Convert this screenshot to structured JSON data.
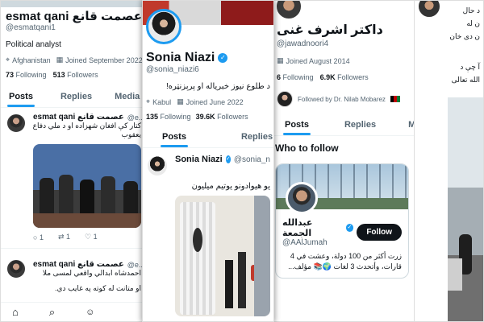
{
  "p1": {
    "name": "esmat qani عصمت قانع",
    "handle": "@esmatqani1",
    "bio": "Political analyst",
    "location": "Afghanistan",
    "joined": "Joined September 2022",
    "following_count": "73",
    "following_label": "Following",
    "followers_count": "513",
    "followers_label": "Followers",
    "tabs": [
      "Posts",
      "Replies",
      "Media"
    ],
    "tweet1": {
      "name": "esmat qani عصمت قانع",
      "handle": "@e...",
      "time": "04",
      "line1": "کتار کې افغان شهزاده او د ملي دفاع",
      "line2": "یعقوب",
      "reply": "1",
      "retweet": "1",
      "like": "1"
    },
    "tweet2": {
      "name": "esmat qani عصمت قانع",
      "handle": "@e...",
      "time": "04",
      "line1": "احمدشاه ابدالي واقعي لمسی ملا",
      "line2": "او متانت له کوته په غایب دي."
    }
  },
  "p2": {
    "name": "Sonia Niazi",
    "handle": "@sonia_niazi6",
    "bio": "د طلوع نیوز خبریاله او پرېزنټره!",
    "location": "Kabul",
    "joined": "Joined June 2022",
    "following_count": "135",
    "following_label": "Following",
    "followers_count": "39.6K",
    "followers_label": "Followers",
    "tabs": [
      "Posts",
      "Replies"
    ],
    "tweet": {
      "name": "Sonia Niazi",
      "handle": "@sonia_n",
      "text": "یو هیوادونو یوتیم میلیون"
    }
  },
  "p3": {
    "name": "داکتر اشرف غنی",
    "handle": "@jawadnoori4",
    "joined": "Joined August 2014",
    "following_count": "6",
    "following_label": "Following",
    "followers_count": "6.9K",
    "followers_label": "Followers",
    "followed_by": "Followed by Dr. Nilab Mobarez",
    "tabs": [
      "Posts",
      "Replies",
      "Media"
    ],
    "who_to_follow": "Who to follow",
    "suggest": {
      "name": "عبدالله الجمعة",
      "handle": "@AAlJumah",
      "follow": "Follow",
      "bio1": "زرت أكثر من 100 دولة، وعشت في 4",
      "bio2": "قارات، وأتحدث 3 لغات 🌍📚 مؤلف..."
    }
  },
  "p4": {
    "lines": [
      "د حال",
      "ن له",
      "ن دی خان",
      "آ چې د",
      "الله تعالی"
    ]
  }
}
